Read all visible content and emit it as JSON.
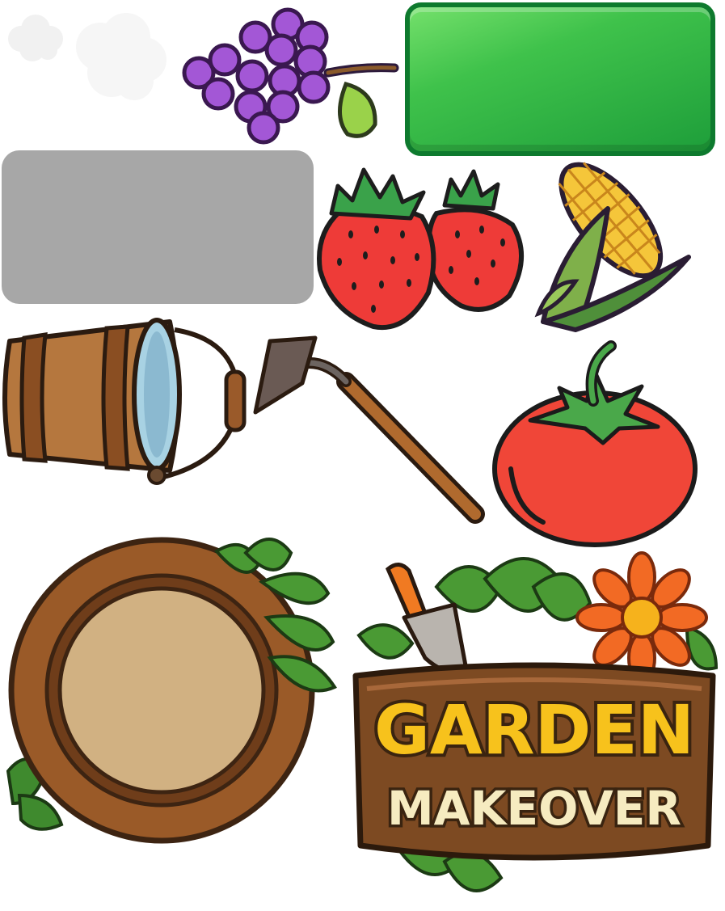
{
  "sheet": {
    "type": "sprite-sheet",
    "assets": [
      {
        "id": "cloud-puff",
        "icon": "cloud-puff-icon"
      },
      {
        "id": "cloud-soft",
        "icon": "cloud-soft-icon"
      },
      {
        "id": "grapes",
        "icon": "grapes-icon"
      },
      {
        "id": "button-green",
        "icon": "button-green"
      },
      {
        "id": "button-grey",
        "icon": "button-grey"
      },
      {
        "id": "strawberries",
        "icon": "strawberries-icon"
      },
      {
        "id": "corn",
        "icon": "corn-icon"
      },
      {
        "id": "water-bucket",
        "icon": "bucket-icon"
      },
      {
        "id": "hoe",
        "icon": "hoe-icon"
      },
      {
        "id": "tomato",
        "icon": "tomato-icon"
      },
      {
        "id": "wooden-ring-frame",
        "icon": "wood-frame-icon"
      },
      {
        "id": "garden-logo",
        "icon": "logo"
      }
    ]
  },
  "logo": {
    "line1": "GARDEN",
    "line2": "MAKEOVER"
  },
  "colors": {
    "button_green": "#2fb544",
    "button_grey": "#a7a7a7",
    "logo_gold": "#f7c21c",
    "logo_cream": "#f6ebc0",
    "wood": "#8a4e22",
    "tomato_red": "#f04638",
    "grape_purple": "#a357d6"
  }
}
